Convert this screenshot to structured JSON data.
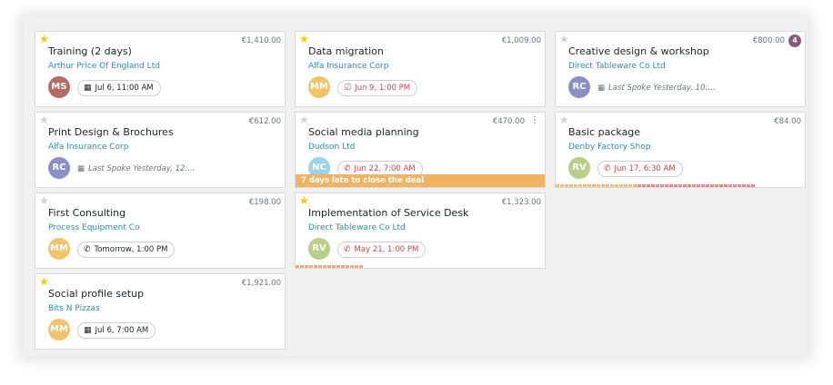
{
  "columns": [
    {
      "cards": [
        {
          "title": "Training (2 days)",
          "company": "Arthur Price Of England Ltd",
          "amount": "€1,410.00",
          "starred": true,
          "avatar_initials": "MS",
          "avatar_color": "#b56a64",
          "activity": {
            "icon": "calendar-icon",
            "text": "Jul 6, 11:00 AM",
            "color": "dark"
          }
        },
        {
          "title": "Print Design & Brochures",
          "company": "Alfa Insurance Corp",
          "amount": "€612.00",
          "starred": false,
          "avatar_initials": "RC",
          "avatar_color": "#8a8fc7",
          "last_spoke": "Last Spoke Yesterday, 12:..."
        },
        {
          "title": "First Consulting",
          "company": "Process Equipment Co",
          "amount": "€198.00",
          "starred": false,
          "avatar_initials": "MM",
          "avatar_color": "#f2c46a",
          "activity": {
            "icon": "phone-icon",
            "text": "Tomorrow, 1:00 PM",
            "color": "dark"
          }
        },
        {
          "title": "Social profile setup",
          "company": "Bits N Pizzas",
          "amount": "€1,921.00",
          "starred": true,
          "avatar_initials": "MM",
          "avatar_color": "#f2c46a",
          "activity": {
            "icon": "calendar-icon",
            "text": "Jul 6, 7:00 AM",
            "color": "dark"
          }
        }
      ]
    },
    {
      "cards": [
        {
          "title": "Data migration",
          "company": "Alfa Insurance Corp",
          "amount": "€1,009.00",
          "starred": true,
          "avatar_initials": "MM",
          "avatar_color": "#f2c46a",
          "activity": {
            "icon": "check-icon",
            "text": "Jun 9, 1:00 PM",
            "color": "red"
          }
        },
        {
          "title": "Social media planning",
          "company": "Dudson Ltd",
          "amount": "€470.00",
          "starred": false,
          "avatar_initials": "NC",
          "avatar_color": "#9cd3e6",
          "activity": {
            "icon": "phone-icon",
            "text": "Jun 22, 7:00 AM",
            "color": "red"
          },
          "ribbon": "7 days late to close the deal"
        },
        {
          "title": "Implementation of Service Desk",
          "company": "Direct Tableware Co Ltd",
          "amount": "€1,323.00",
          "starred": true,
          "avatar_initials": "RV",
          "avatar_color": "#b7cf86",
          "activity": {
            "icon": "phone-icon",
            "text": "May 21, 1:00 PM",
            "color": "red"
          },
          "progress": 0.27
        }
      ]
    },
    {
      "cards": [
        {
          "title": "Creative design & workshop",
          "company": "Direct Tableware Co Ltd",
          "amount": "€800.00",
          "starred": false,
          "badge": "4",
          "avatar_initials": "RC",
          "avatar_color": "#8a8fc7",
          "last_spoke": "Last Spoke Yesterday, 10:..."
        },
        {
          "title": "Basic package",
          "company": "Denby Factory Shop",
          "amount": "€84.00",
          "starred": false,
          "avatar_initials": "RV",
          "avatar_color": "#b7cf86",
          "activity": {
            "icon": "phone-icon",
            "text": "Jun 17, 6:30 AM",
            "color": "red"
          },
          "progress": 0.8
        }
      ]
    }
  ]
}
